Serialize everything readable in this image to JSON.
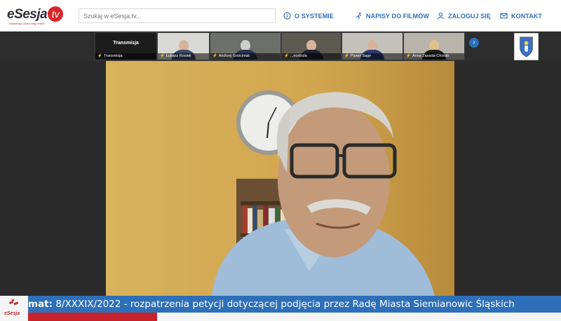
{
  "header": {
    "logo_text": "eSesja",
    "logo_tv": "tv",
    "logo_tagline": "Transmisja obrad sesji online",
    "search_placeholder": "Szukaj w eSesja.tv...",
    "nav": [
      {
        "label": "O SYSTEMIE",
        "icon": "info-circle-icon"
      },
      {
        "label": "NAPISY DO FILMÓW",
        "icon": "running-figure-icon"
      },
      {
        "label": "ZALOGUJ SIĘ",
        "icon": "user-icon"
      },
      {
        "label": "KONTAKT",
        "icon": "envelope-icon"
      }
    ]
  },
  "participants": {
    "transmission_title": "Transmisja",
    "tiles": [
      {
        "name": "Transmisja"
      },
      {
        "name": "Łukasz Rosiek"
      },
      {
        "name": "Andrzej Gościniak"
      },
      {
        "name": "...ecebula"
      },
      {
        "name": "Paweł Sage"
      },
      {
        "name": "Anna Zasada-Chorab"
      }
    ],
    "next_icon": "chevron-right-icon",
    "crest_icon": "coat-of-arms-icon"
  },
  "ticker": {
    "prefix": "mat:",
    "text": "8/XXXIX/2022 - rozpatrzenia petycji dotyczącej podjęcia przez Radę Miasta Siemianowic Śląskich",
    "logo_label": "eSesja"
  },
  "colors": {
    "accent": "#2d6fb8",
    "brand_red": "#d9262b",
    "ticker_blue": "#2d6fb8"
  }
}
